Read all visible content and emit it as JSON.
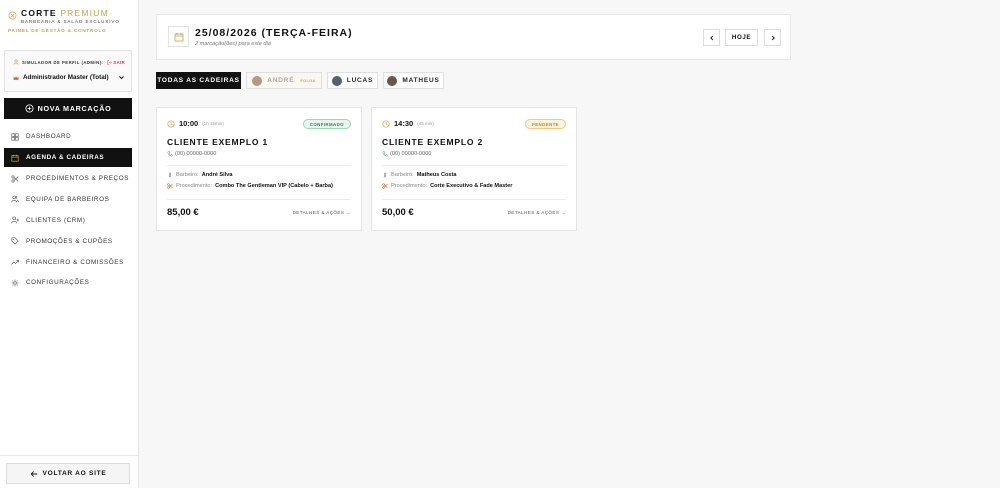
{
  "brand": {
    "name_main": "CORTE",
    "name_accent": "PREMIUM",
    "tagline": "BARBEARIA & SALÃO EXCLUSIVO",
    "panel": "PAINEL DE GESTÃO & CONTROLO"
  },
  "simulator": {
    "label": "SIMULADOR DE PERFIL (ADMIN):",
    "logout": "SAIR",
    "selected": "Administrador Master (Total)"
  },
  "new_booking": "NOVA MARCAÇÃO",
  "nav": [
    {
      "label": "DASHBOARD",
      "icon": "dashboard-icon"
    },
    {
      "label": "AGENDA & CADEIRAS",
      "icon": "calendar-icon",
      "active": true
    },
    {
      "label": "PROCEDIMENTOS & PREÇOS",
      "icon": "scissors-icon"
    },
    {
      "label": "EQUIPA DE BARBEIROS",
      "icon": "team-icon"
    },
    {
      "label": "CLIENTES (CRM)",
      "icon": "clients-icon"
    },
    {
      "label": "PROMOÇÕES & CUPÕES",
      "icon": "tag-icon"
    },
    {
      "label": "FINANCEIRO & COMISSÕES",
      "icon": "trend-icon"
    },
    {
      "label": "CONFIGURAÇÕES",
      "icon": "gear-icon"
    }
  ],
  "back_to_site": "VOLTAR AO SITE",
  "header": {
    "date_title": "25/08/2026 (TERÇA-FEIRA)",
    "subtitle": "2 marcação(ões) para este dia",
    "today": "HOJE"
  },
  "chairs": [
    {
      "label": "TODAS AS CADEIRAS",
      "active": true
    },
    {
      "label": "ANDRÉ",
      "badge": "FOLGA",
      "off": true
    },
    {
      "label": "LUCAS"
    },
    {
      "label": "MATHEUS"
    }
  ],
  "bookings": [
    {
      "time": "10:00",
      "duration": "(1h 15min)",
      "status": "CONFIRMADO",
      "client": "CLIENTE EXEMPLO 1",
      "phone": "(00) 00000-0000",
      "barber_label": "Barbeiro:",
      "barber": "André Silva",
      "procedure_label": "Procedimento:",
      "procedure": "Combo The Gentleman VIP (Cabelo + Barba)",
      "price": "85,00 €",
      "details": "DETALHES & AÇÕES →"
    },
    {
      "time": "14:30",
      "duration": "(45 min)",
      "status": "PENDENTE",
      "client": "CLIENTE EXEMPLO 2",
      "phone": "(00) 00000-0000",
      "barber_label": "Barbeiro:",
      "barber": "Matheus Costa",
      "procedure_label": "Procedimento:",
      "procedure": "Corte Executivo & Fade Master",
      "price": "50,00 €",
      "details": "DETALHES & AÇÕES →"
    }
  ],
  "colors": {
    "accent_gold": "#c8a24a",
    "dark": "#111111",
    "confirmed": "#2f8a52",
    "pending": "#d2861d",
    "logout": "#d93a3a"
  }
}
